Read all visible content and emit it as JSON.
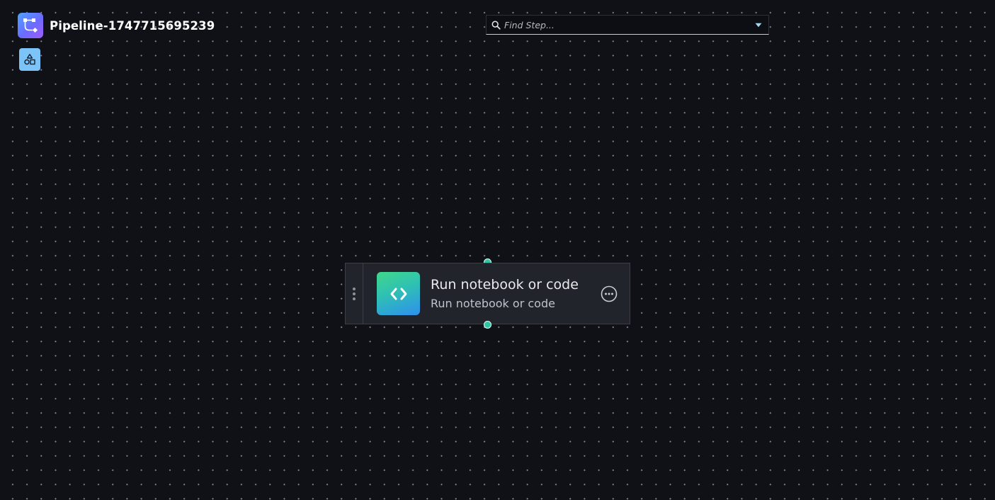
{
  "header": {
    "pipeline_name": "Pipeline-1747715695239",
    "pipeline_icon": "pipeline-flow-icon",
    "shapes_button_icon": "shapes-icon"
  },
  "search": {
    "placeholder": "Find Step...",
    "value": "",
    "icon": "search-icon",
    "dropdown_icon": "caret-down-icon"
  },
  "node": {
    "title": "Run notebook or code",
    "subtitle": "Run notebook or code",
    "icon": "code-brackets-icon",
    "menu_icon": "more-options-icon",
    "drag_handle_icon": "drag-handle-icon"
  },
  "colors": {
    "background": "#101117",
    "node_background": "#22242c",
    "port": "#2fc6a6",
    "accent_button": "#7cc4f8"
  }
}
